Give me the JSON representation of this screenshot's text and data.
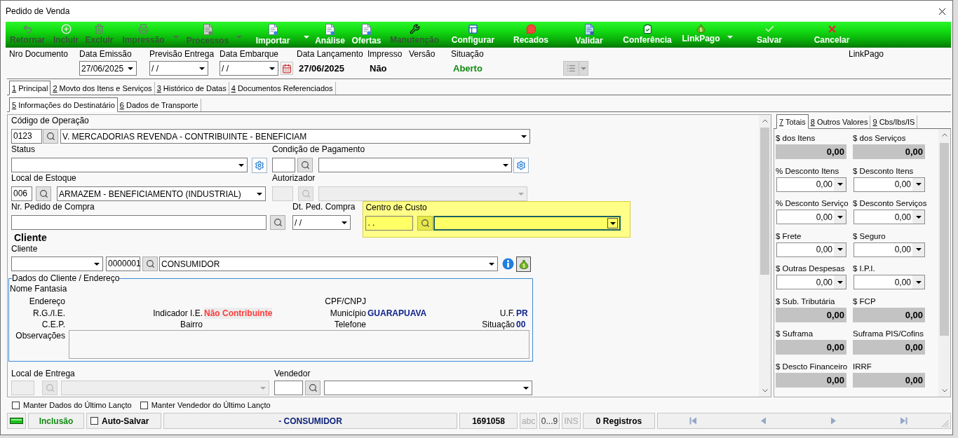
{
  "window": {
    "title": "Pedido de Venda"
  },
  "toolbar": [
    {
      "label": "Retornar",
      "disabled": true,
      "dropdown": false
    },
    {
      "label": "Incluir",
      "disabled": true,
      "dropdown": false
    },
    {
      "label": "Excluir",
      "disabled": true,
      "dropdown": false
    },
    {
      "label": "Impressão",
      "disabled": true,
      "dropdown": true
    },
    {
      "label": "Processos",
      "disabled": true,
      "dropdown": true
    },
    {
      "label": "Importar",
      "disabled": false,
      "dropdown": true
    },
    {
      "label": "Análise",
      "disabled": false,
      "dropdown": false
    },
    {
      "label": "Ofertas",
      "disabled": false,
      "dropdown": false
    },
    {
      "label": "Manutenção",
      "disabled": true,
      "dropdown": false
    },
    {
      "label": "Configurar",
      "disabled": false,
      "dropdown": false
    },
    {
      "label": "Recados",
      "disabled": false,
      "dropdown": false
    },
    {
      "label": "Validar",
      "disabled": false,
      "dropdown": false
    },
    {
      "label": "Conferência",
      "disabled": false,
      "dropdown": false
    },
    {
      "label": "LinkPago",
      "disabled": false,
      "dropdown": true
    },
    {
      "label": "Salvar",
      "disabled": false,
      "dropdown": false
    },
    {
      "label": "Cancelar",
      "disabled": false,
      "dropdown": false
    }
  ],
  "header": [
    {
      "kind": "plain",
      "label": "Nro Documento"
    },
    {
      "kind": "combo",
      "label": "Data Emissão",
      "value": "27/06/2025"
    },
    {
      "kind": "combo",
      "label": "Previsão Entrega",
      "value": "/ /"
    },
    {
      "kind": "combo_calendar",
      "label": "Data Embarque",
      "value": "/ /"
    },
    {
      "kind": "bold",
      "label": "Data Lançamento",
      "value": "27/06/2025"
    },
    {
      "kind": "bold",
      "label": "Impresso",
      "value": "Não"
    },
    {
      "kind": "plain",
      "label": "Versão"
    },
    {
      "kind": "status",
      "label": "Situação",
      "value": "Aberto"
    },
    {
      "kind": "menu"
    },
    {
      "kind": "plain",
      "label": "LinkPago"
    }
  ],
  "tabs": [
    {
      "key": "1",
      "label": "Principal",
      "selected": true
    },
    {
      "key": "2",
      "label": "Movto dos Itens e Serviços",
      "selected": false
    },
    {
      "key": "3",
      "label": "Histórico de Datas",
      "selected": false
    },
    {
      "key": "4",
      "label": "Documentos Referenciados",
      "selected": false
    }
  ],
  "subtabs": [
    {
      "key": "5",
      "label": "Informações do Destinatário",
      "selected": true
    },
    {
      "key": "6",
      "label": "Dados de Transporte",
      "selected": false
    }
  ],
  "form": {
    "operacao": {
      "label": "Código de Operação",
      "code": "0123",
      "description": "V. MERCADORIAS REVENDA - CONTRIBUINTE - BENEFICIAM",
      "disabled": false
    },
    "status": {
      "label": "Status"
    },
    "condicao_pagamento": {
      "label": "Condição de Pagamento",
      "disabled": false
    },
    "local_estoque": {
      "label": "Local de Estoque",
      "code": "006",
      "description": "ARMAZEM - BENEFICIAMENTO (INDUSTRIAL)",
      "disabled": false
    },
    "autorizador": {
      "label": "Autorizador",
      "disabled": true
    },
    "pedido_compra": {
      "label": "Nr. Pedido de Compra"
    },
    "dt_pedido_compra": {
      "label": "Dt. Ped. Compra",
      "value": "/ /"
    },
    "centro_custo": {
      "label": "Centro de Custo",
      "code": ". .",
      "highlighted": true,
      "focused": true
    },
    "cliente": {
      "heading": "Cliente",
      "label": "Cliente",
      "code": "0000001",
      "name": "CONSUMIDOR"
    },
    "dados_cliente": {
      "legend": "Dados do Cliente / Endereço",
      "nome_fantasia": "Nome Fantasia",
      "endereco": "Endereço",
      "cpf_cnpj": "CPF/CNPJ",
      "rg_ie": "R.G./I.E.",
      "indicador_ie": {
        "label": "Indicador I.E.",
        "value": "Não Contribuinte"
      },
      "municipio": {
        "label": "Município",
        "value": "GUARAPUAVA"
      },
      "uf": {
        "label": "U.F.",
        "value": "PR"
      },
      "cep": "C.E.P.",
      "bairro": "Bairro",
      "telefone": "Telefone",
      "situacao": {
        "label": "Situação",
        "value": "00"
      },
      "observacoes": "Observações"
    },
    "local_entrega": {
      "label": "Local de Entrega",
      "disabled": true
    },
    "vendedor": {
      "label": "Vendedor",
      "disabled": false
    }
  },
  "totals": {
    "tabs": [
      {
        "key": "7",
        "label": "Totais",
        "selected": true
      },
      {
        "key": "8",
        "label": "Outros Valores",
        "selected": false
      },
      {
        "key": "9",
        "label": "Cbs/Ibs/IS",
        "selected": false
      }
    ],
    "fields": [
      {
        "label": "$ dos Itens",
        "field": {
          "kind": "readonly",
          "value": "0,00"
        }
      },
      {
        "label": "$ dos Serviços",
        "field": {
          "kind": "readonly",
          "value": "0,00"
        }
      },
      {
        "label": "% Desconto Itens",
        "field": {
          "kind": "combo",
          "value": "0,00"
        }
      },
      {
        "label": "$ Desconto Itens",
        "field": {
          "kind": "combo",
          "value": "0,00"
        }
      },
      {
        "label": "% Desconto Serviço",
        "field": {
          "kind": "combo",
          "value": "0,00"
        }
      },
      {
        "label": "$ Desconto Serviços",
        "field": {
          "kind": "combo",
          "value": "0,00"
        }
      },
      {
        "label": "$ Frete",
        "field": {
          "kind": "combo",
          "value": "0,00"
        }
      },
      {
        "label": "$ Seguro",
        "field": {
          "kind": "combo",
          "value": "0,00"
        }
      },
      {
        "label": "$ Outras Despesas",
        "field": {
          "kind": "combo",
          "value": "0,00"
        }
      },
      {
        "label": "$ I.P.I.",
        "field": {
          "kind": "combo",
          "value": "0,00"
        }
      },
      {
        "label": "$ Sub. Tributária",
        "field": {
          "kind": "readonly",
          "value": "0,00"
        }
      },
      {
        "label": "$ FCP",
        "field": {
          "kind": "readonly",
          "value": "0,00"
        }
      },
      {
        "label": "$ Suframa",
        "field": {
          "kind": "readonly",
          "value": "0,00"
        }
      },
      {
        "label": "Suframa PIS/Cofins",
        "field": {
          "kind": "readonly",
          "value": "0,00"
        }
      },
      {
        "label": "$ Descto Financeiro",
        "field": {
          "kind": "readonly",
          "value": "0,00"
        }
      },
      {
        "label": "IRRF",
        "field": {
          "kind": "readonly",
          "value": "0,00"
        }
      }
    ]
  },
  "options": [
    {
      "label": "Manter Dados do Último Lançto",
      "checked": false
    },
    {
      "label": "Manter Vendedor do Último Lançto",
      "checked": false
    }
  ],
  "status_bar": {
    "mode": "Inclusão",
    "auto_save": {
      "label": "Auto-Salvar",
      "checked": false
    },
    "client": "- CONSUMIDOR",
    "code": "1691058",
    "indicators": [
      {
        "label": "abc",
        "on": false
      },
      {
        "label": "0...9",
        "on": true
      },
      {
        "label": "INS",
        "on": false
      }
    ],
    "records": "0 Registros"
  }
}
